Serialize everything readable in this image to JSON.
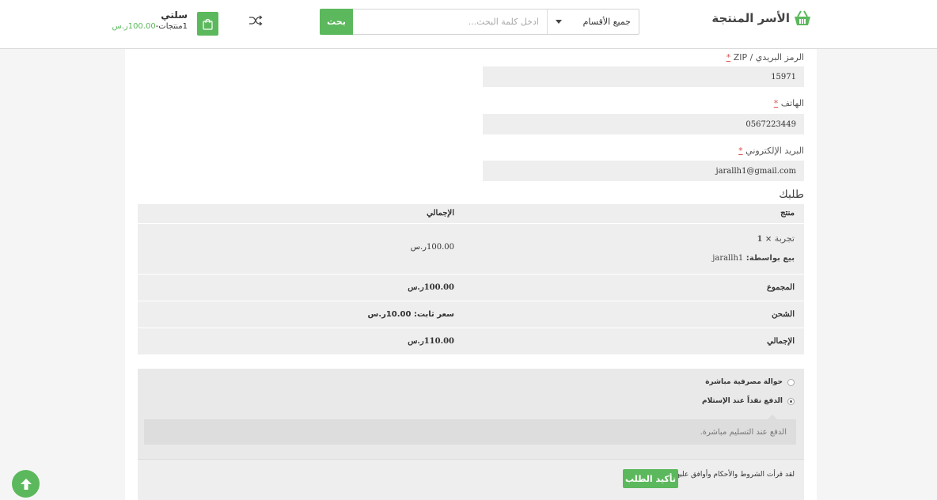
{
  "header": {
    "logo_text": "الأسر المنتجة",
    "search": {
      "category": "جميع الأقسام",
      "placeholder": "ادخل كلمة البحث...",
      "button": "بحث"
    },
    "cart": {
      "title": "سلتي",
      "count_text": "1منتجات-",
      "total": "100.00ر.س"
    }
  },
  "form": {
    "zip": {
      "label": "الرمز البريدي / ZIP",
      "required": "*",
      "value": "15971"
    },
    "phone": {
      "label": "الهاتف",
      "required": "*",
      "value": "0567223449"
    },
    "email": {
      "label": "البريد الإلكتروني",
      "required": "*",
      "value": "jarallh1@gmail.com"
    }
  },
  "order": {
    "title": "طلبك",
    "headers": {
      "product": "منتج",
      "total": "الإجمالي"
    },
    "item": {
      "name": "تجربة",
      "qty": "× 1",
      "sold_by_label": "بيع بواسطة:",
      "seller": "jarallh1",
      "price": "100.00ر.س"
    },
    "subtotal": {
      "label": "المجموع",
      "value": "100.00ر.س"
    },
    "shipping": {
      "label": "الشحن",
      "value": "سعر ثابت: 10.00ر.س"
    },
    "grand_total": {
      "label": "الإجمالي",
      "value": "110.00ر.س"
    }
  },
  "payment": {
    "options": [
      {
        "label": "حوالة مصرفية مباشرة",
        "selected": false
      },
      {
        "label": "الدفع نقداً عند الإستلام",
        "selected": true
      }
    ],
    "description": "الدفع عند التسليم مباشرة."
  },
  "confirm": {
    "terms": "لقد قرأت الشروط والأحكام وأوافق عليها",
    "required": "*",
    "button": "تأكيد الطلب"
  },
  "colors": {
    "accent": "#5cb85c",
    "required": "#d9534f"
  }
}
